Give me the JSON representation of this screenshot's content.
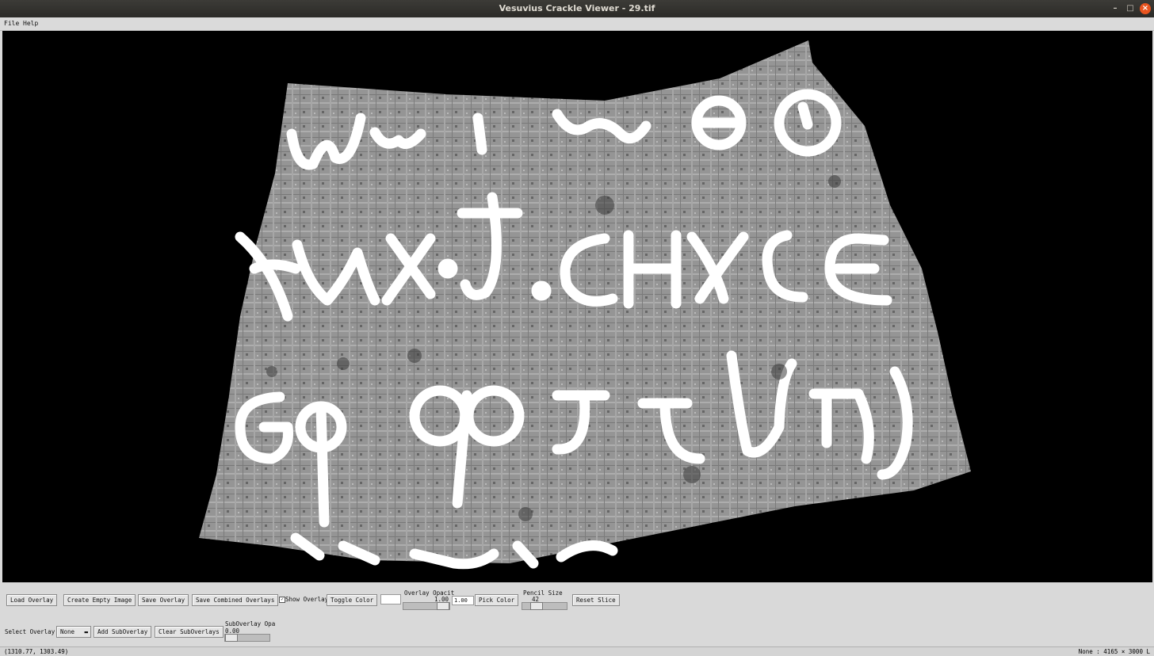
{
  "window": {
    "title": "Vesuvius Crackle Viewer - 29.tif"
  },
  "menu": {
    "file": "File",
    "help": "Help"
  },
  "controls": {
    "load_overlay": "Load Overlay",
    "create_empty_image": "Create Empty Image",
    "save_overlay": "Save Overlay",
    "save_combined_overlays": "Save Combined Overlays",
    "show_overlay_label": "Show Overlay",
    "show_overlay_checked": true,
    "toggle_color": "Toggle Color",
    "overlay_opacity_label": "Overlay Opacit",
    "overlay_opacity_value": "1.00",
    "overlay_opacity_entry": "1.00",
    "overlay_opacity_level": 1.0,
    "pick_color": "Pick Color",
    "pencil_size_label": "Pencil Size",
    "pencil_size_value": "42",
    "reset_slice": "Reset Slice",
    "select_overlay_label": "Select Overlay:",
    "select_overlay_value": "None",
    "add_suboverlay": "Add SubOverlay",
    "clear_suboverlays": "Clear SubOverlays",
    "suboverlay_opacity_label": "SubOverlay Opa",
    "suboverlay_opacity_value": "0.00",
    "suboverlay_opacity_level": 0.0
  },
  "status": {
    "coords": "(1310.77, 1303.49)",
    "info": "None : 4165 × 3000 L"
  },
  "colors": {
    "overlay_ink": "#ffffff",
    "papyrus": "#8a8a8a",
    "canvas": "#000000"
  }
}
